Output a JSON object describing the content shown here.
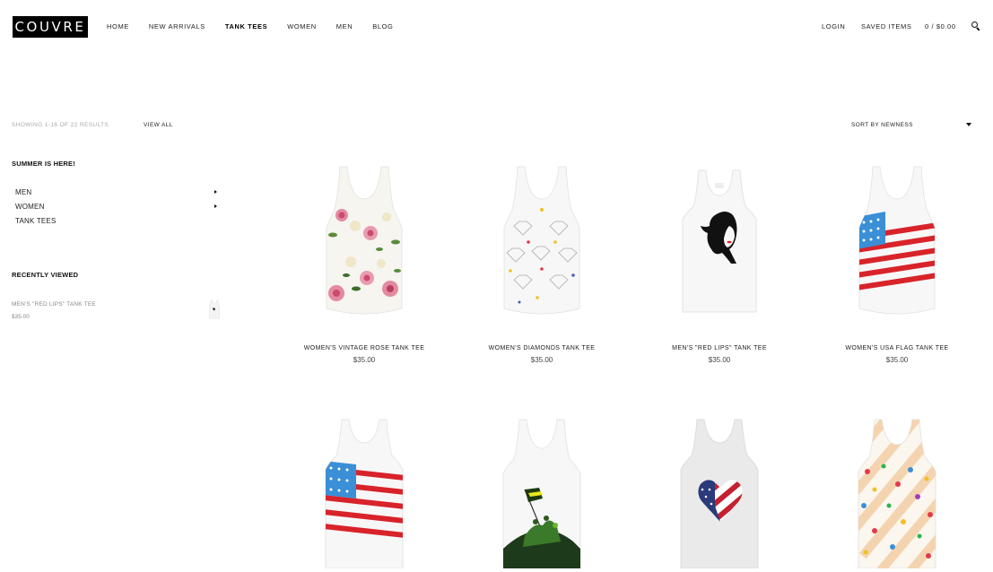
{
  "header": {
    "logo": "COUVRE",
    "nav": [
      "HOME",
      "NEW ARRIVALS",
      "TANK TEES",
      "WOMEN",
      "MEN",
      "BLOG"
    ],
    "active_nav": "TANK TEES",
    "login": "LOGIN",
    "saved_items": "SAVED ITEMS",
    "cart": "0 / $0.00"
  },
  "toolbar": {
    "results": "SHOWING 1-16 OF 22 RESULTS",
    "view_all": "VIEW ALL",
    "sort": "SORT BY NEWNESS"
  },
  "sidebar": {
    "promo_heading": "SUMMER IS HERE!",
    "categories": [
      {
        "label": "MEN",
        "expandable": true
      },
      {
        "label": "WOMEN",
        "expandable": true
      },
      {
        "label": "TANK TEES",
        "expandable": false
      }
    ],
    "recently_viewed_heading": "RECENTLY VIEWED",
    "recent": {
      "name": "MEN'S \"RED LIPS\" TANK TEE",
      "price": "$35.00"
    }
  },
  "products": [
    {
      "name": "WOMEN'S VINTAGE ROSE TANK TEE",
      "price": "$35.00",
      "pattern": "roses"
    },
    {
      "name": "WOMEN'S DIAMONDS TANK TEE",
      "price": "$35.00",
      "pattern": "diamonds"
    },
    {
      "name": "MEN'S \"RED LIPS\" TANK TEE",
      "price": "$35.00",
      "pattern": "face"
    },
    {
      "name": "WOMEN'S USA FLAG TANK TEE",
      "price": "$35.00",
      "pattern": "flag"
    },
    {
      "name": "",
      "price": "",
      "pattern": "flag"
    },
    {
      "name": "",
      "price": "",
      "pattern": "flag-raising"
    },
    {
      "name": "",
      "price": "",
      "pattern": "heart-flag"
    },
    {
      "name": "",
      "price": "",
      "pattern": "dots-stripes"
    }
  ],
  "colors": {
    "logo_bg": "#000000",
    "text": "#222222",
    "muted": "#aaaaaa",
    "flag_red": "#d8232a",
    "flag_blue": "#3a8fd6"
  }
}
